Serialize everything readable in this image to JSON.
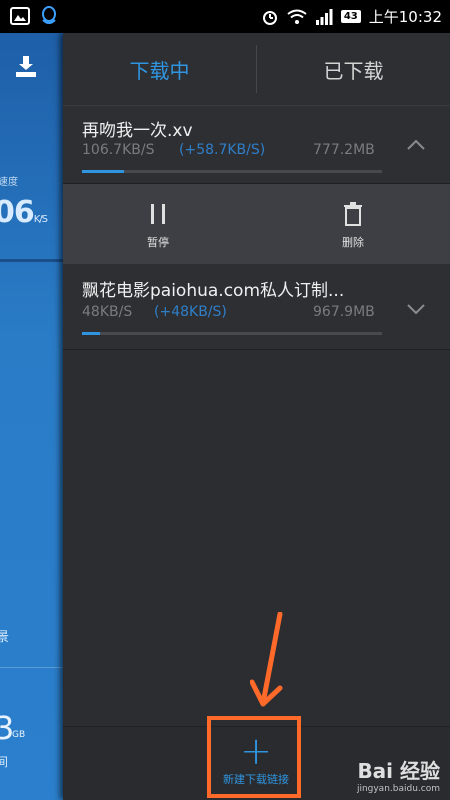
{
  "status_bar": {
    "time": "上午10:32",
    "battery": "43",
    "icons": [
      "image-icon",
      "qq-icon",
      "alarm-icon",
      "wifi-icon",
      "signal-icon",
      "battery-icon"
    ]
  },
  "side_panel": {
    "speed_label": "速度",
    "speed_value": "06",
    "speed_unit": "K/S",
    "text1": "景",
    "storage_value": "3",
    "storage_unit": "GB",
    "text2": "间"
  },
  "tabs": {
    "downloading": "下载中",
    "downloaded": "已下载"
  },
  "downloads": [
    {
      "title": "再吻我一次.xv",
      "speed": "106.7KB/S",
      "delta": "(+58.7KB/S)",
      "size": "777.2MB",
      "progress": 0.14
    },
    {
      "title": "飘花电影paiohua.com私人订制...",
      "speed": "48KB/S",
      "delta": "(+48KB/S)",
      "size": "967.9MB",
      "progress": 0.06
    }
  ],
  "actions": {
    "pause": "暂停",
    "delete": "删除"
  },
  "bottom": {
    "new_download": "新建下载链接",
    "plus": "+"
  },
  "watermark": {
    "logo": "Bai 经验",
    "sub": "jingyan.baidu.com"
  },
  "colors": {
    "accent": "#2f95e0",
    "annotation": "#ff6a2b"
  }
}
